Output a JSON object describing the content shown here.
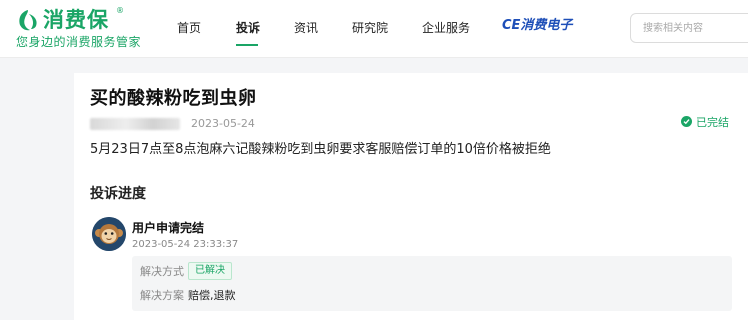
{
  "header": {
    "logo": {
      "name": "消费保",
      "registered": "®",
      "tagline": "您身边的消费服务管家"
    },
    "nav": {
      "items": [
        {
          "label": "首页",
          "active": false
        },
        {
          "label": "投诉",
          "active": true
        },
        {
          "label": "资讯",
          "active": false
        },
        {
          "label": "研究院",
          "active": false
        },
        {
          "label": "企业服务",
          "active": false
        }
      ],
      "brand": {
        "prefix": "CE",
        "label": "消费电子"
      }
    },
    "search": {
      "placeholder": "搜索相关内容"
    }
  },
  "complaint": {
    "title": "买的酸辣粉吃到虫卵",
    "date": "2023-05-24",
    "status": "已完结",
    "summary": "5月23日7点至8点泡麻六记酸辣粉吃到虫卵要求客服赔偿订单的10倍价格被拒绝"
  },
  "progress": {
    "section_title": "投诉进度",
    "steps": [
      {
        "title": "用户申请完结",
        "time": "2023-05-24 23:33:37",
        "resolution_label": "解决方式",
        "resolution_tag": "已解决",
        "plan_label": "解决方案",
        "plan_value": "赔偿,退款"
      }
    ]
  },
  "colors": {
    "brand_green": "#1aa566",
    "ce_blue": "#1e4fb8",
    "avatar_bg": "#24476b"
  },
  "icons": {
    "logo": "leaf-logo-icon",
    "status": "check-circle-icon",
    "avatar": "monkey-avatar-icon"
  }
}
